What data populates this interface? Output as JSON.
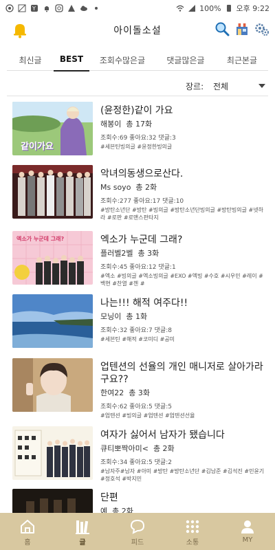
{
  "status": {
    "battery": "100%",
    "time": "오후 9:22"
  },
  "app": {
    "title": "아이돌소설"
  },
  "tabs": [
    {
      "label": "최신글"
    },
    {
      "label": "BEST"
    },
    {
      "label": "조회수많은글"
    },
    {
      "label": "댓글많은글"
    },
    {
      "label": "최근본글"
    }
  ],
  "filter": {
    "label": "장르:",
    "value": "전체"
  },
  "posts": [
    {
      "title": "(윤정한)같이 가요",
      "author": "해봉이",
      "episodes": "총 17화",
      "stats": "조회수:69   좋아요:32   댓글:3",
      "tags": "#세븐틴빙의글 #윤정한빙의글",
      "thumb_text": "같이가요"
    },
    {
      "title": "악녀의동생으로산다.",
      "author": "Ms soyo",
      "episodes": "총 2화",
      "stats": "조회수:277   좋아요:17   댓글:10",
      "tags": "#방탄소년단 #방탄 #빙의글 #방탄소년단빙의글 #방탄빙의글 #넷하라 #로판 #로맨스판타지",
      "thumb_text": ""
    },
    {
      "title": "엑소가 누군데 그래?",
      "author": "플러벨2벨",
      "episodes": "총 3화",
      "stats": "조회수:45   좋아요:12   댓글:1",
      "tags": "#엑소 #빙의글 #엑소빙의글 #EXO #엑빙 #수호 #시우민 #레이 #백현 #찬열 #첸 #",
      "thumb_text": "엑소가 누군데 그래?"
    },
    {
      "title": "나는!!! 해적 여주다!!",
      "author": "모닝이",
      "episodes": "총 1화",
      "stats": "조회수:32   좋아요:7   댓글:8",
      "tags": "#세븐틴 #해적 #코미디 #공미",
      "thumb_text": ""
    },
    {
      "title": "업텐션의 선율의 개인 매니저로 살아가라구요??",
      "author": "한여22",
      "episodes": "총 3화",
      "stats": "조회수:62   좋아요:5   댓글:5",
      "tags": "#업텐션 #빙의글 #업텐션 #업텐션선율",
      "thumb_text": ""
    },
    {
      "title": "여자가 싫어서 남자가 됐습니다",
      "author": "큐티뽀짝아미<",
      "episodes": "총 2화",
      "stats": "조회수:34   좋아요:5   댓글:2",
      "tags": "#남자주#남자 #아미 #방탄 #방탄소년단 #김남준 #김석진 #민윤기 #정호석 #박지민",
      "thumb_text": ""
    },
    {
      "title": "단편",
      "author": "예",
      "episodes": "총 2화",
      "stats": "",
      "tags": "",
      "thumb_text": ""
    }
  ],
  "nav": [
    {
      "label": "홈",
      "icon": "home-icon"
    },
    {
      "label": "글",
      "icon": "books-icon"
    },
    {
      "label": "피드",
      "icon": "chat-icon"
    },
    {
      "label": "소통",
      "icon": "grid-icon"
    },
    {
      "label": "MY",
      "icon": "person-icon"
    }
  ],
  "colors": {
    "nav_bg": "#d8c8a0",
    "accent_bell": "#f5b800"
  }
}
